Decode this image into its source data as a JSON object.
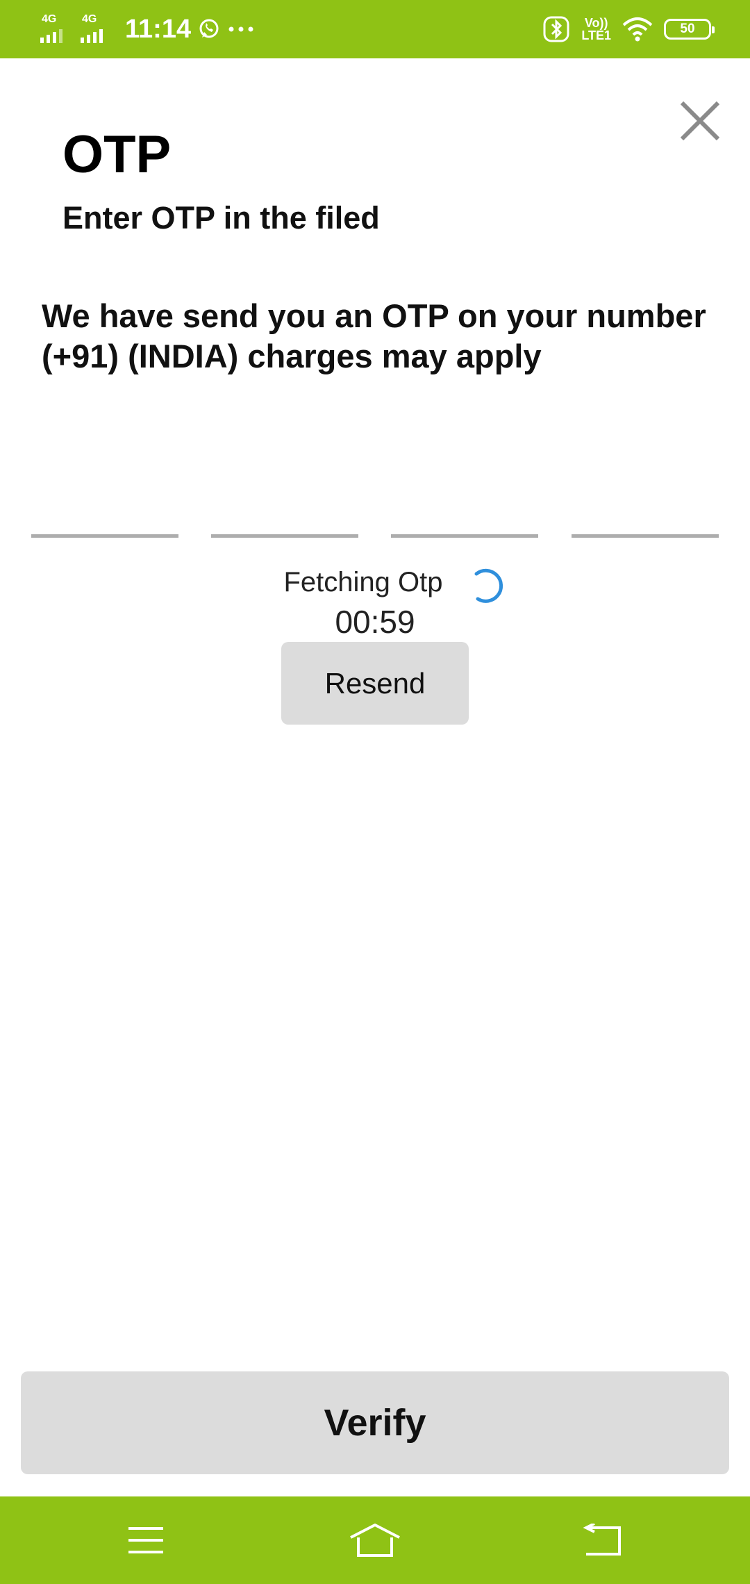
{
  "status_bar": {
    "network_1": "4G",
    "network_2": "4G",
    "time": "11:14",
    "volte_top": "Vo))",
    "volte_bottom": "LTE1",
    "battery": "50",
    "icons": [
      "signal-icon",
      "whatsapp-icon",
      "more-dots-icon",
      "bluetooth-icon",
      "wifi-icon",
      "battery-icon"
    ]
  },
  "header": {
    "title": "OTP",
    "subtitle": "Enter OTP in the filed",
    "close_icon": "close-icon"
  },
  "message": "We have send you an OTP on your number\n(+91)  (INDIA) charges may apply",
  "otp": {
    "digits": [
      "",
      "",
      "",
      ""
    ],
    "status_text": "Fetching Otp",
    "timer": "00:59",
    "resend_label": "Resend"
  },
  "verify_label": "Verify",
  "nav_bar": {
    "icons": [
      "menu-icon",
      "home-icon",
      "back-icon"
    ]
  },
  "colors": {
    "accent": "#8fc215",
    "spinner": "#2f8fdc",
    "button_bg": "#dcdcdc"
  }
}
